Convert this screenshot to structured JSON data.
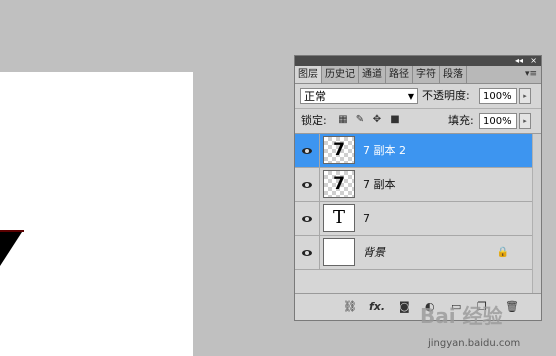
{
  "panel": {
    "tabs": [
      "图层",
      "历史记",
      "通道",
      "路径",
      "字符",
      "段落"
    ],
    "collapse_icon": "double-chevron-left-icon",
    "close_icon": "close-icon",
    "menu_icon": "panel-menu-icon",
    "blend_mode": "正常",
    "opacity_label": "不透明度:",
    "opacity_value": "100%",
    "lock_label": "锁定:",
    "fill_label": "填充:",
    "fill_value": "100%"
  },
  "layers": [
    {
      "name": "7 副本 2",
      "thumb": "7",
      "selected": true
    },
    {
      "name": "7 副本",
      "thumb": "7",
      "selected": false
    },
    {
      "name": "7",
      "thumb": "T",
      "selected": false
    },
    {
      "name": "背景",
      "thumb": "",
      "selected": false
    }
  ],
  "watermark": {
    "logo": "Bai 经验",
    "site": "jingyan.baidu.com"
  },
  "colors": {
    "selected": "#3d95f0",
    "workspace": "#c0c0c0"
  }
}
